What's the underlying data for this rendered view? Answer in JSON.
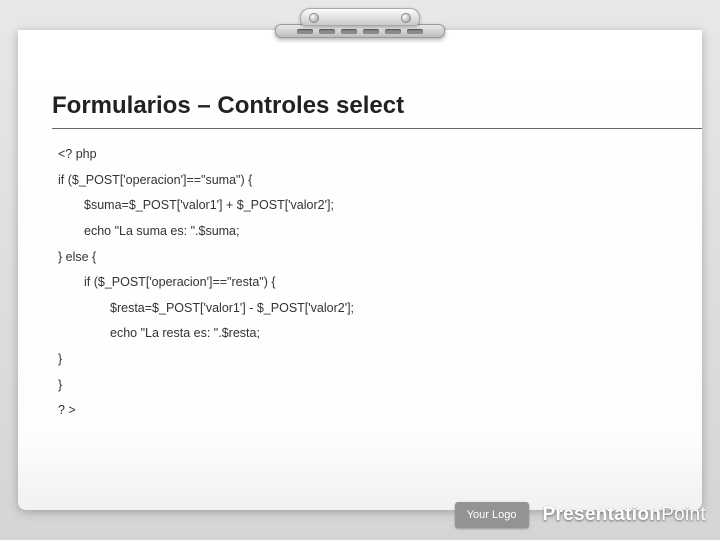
{
  "slide": {
    "title": "Formularios – Controles select",
    "code": {
      "l1": "<? php",
      "l2": "if ($_POST['operacion']==\"suma\") {",
      "l3": "$suma=$_POST['valor1'] + $_POST['valor2'];",
      "l4": "echo \"La suma es: \".$suma;",
      "l5": "} else {",
      "l6": "if ($_POST['operacion']==\"resta\") {",
      "l7": "$resta=$_POST['valor1'] - $_POST['valor2'];",
      "l8": "echo \"La resta es: \".$resta;",
      "l9": "}",
      "l10": "}",
      "l11": "? >"
    }
  },
  "footer": {
    "logo_label": "Your Logo",
    "brand_bold": "Presentation",
    "brand_thin": "Point"
  }
}
